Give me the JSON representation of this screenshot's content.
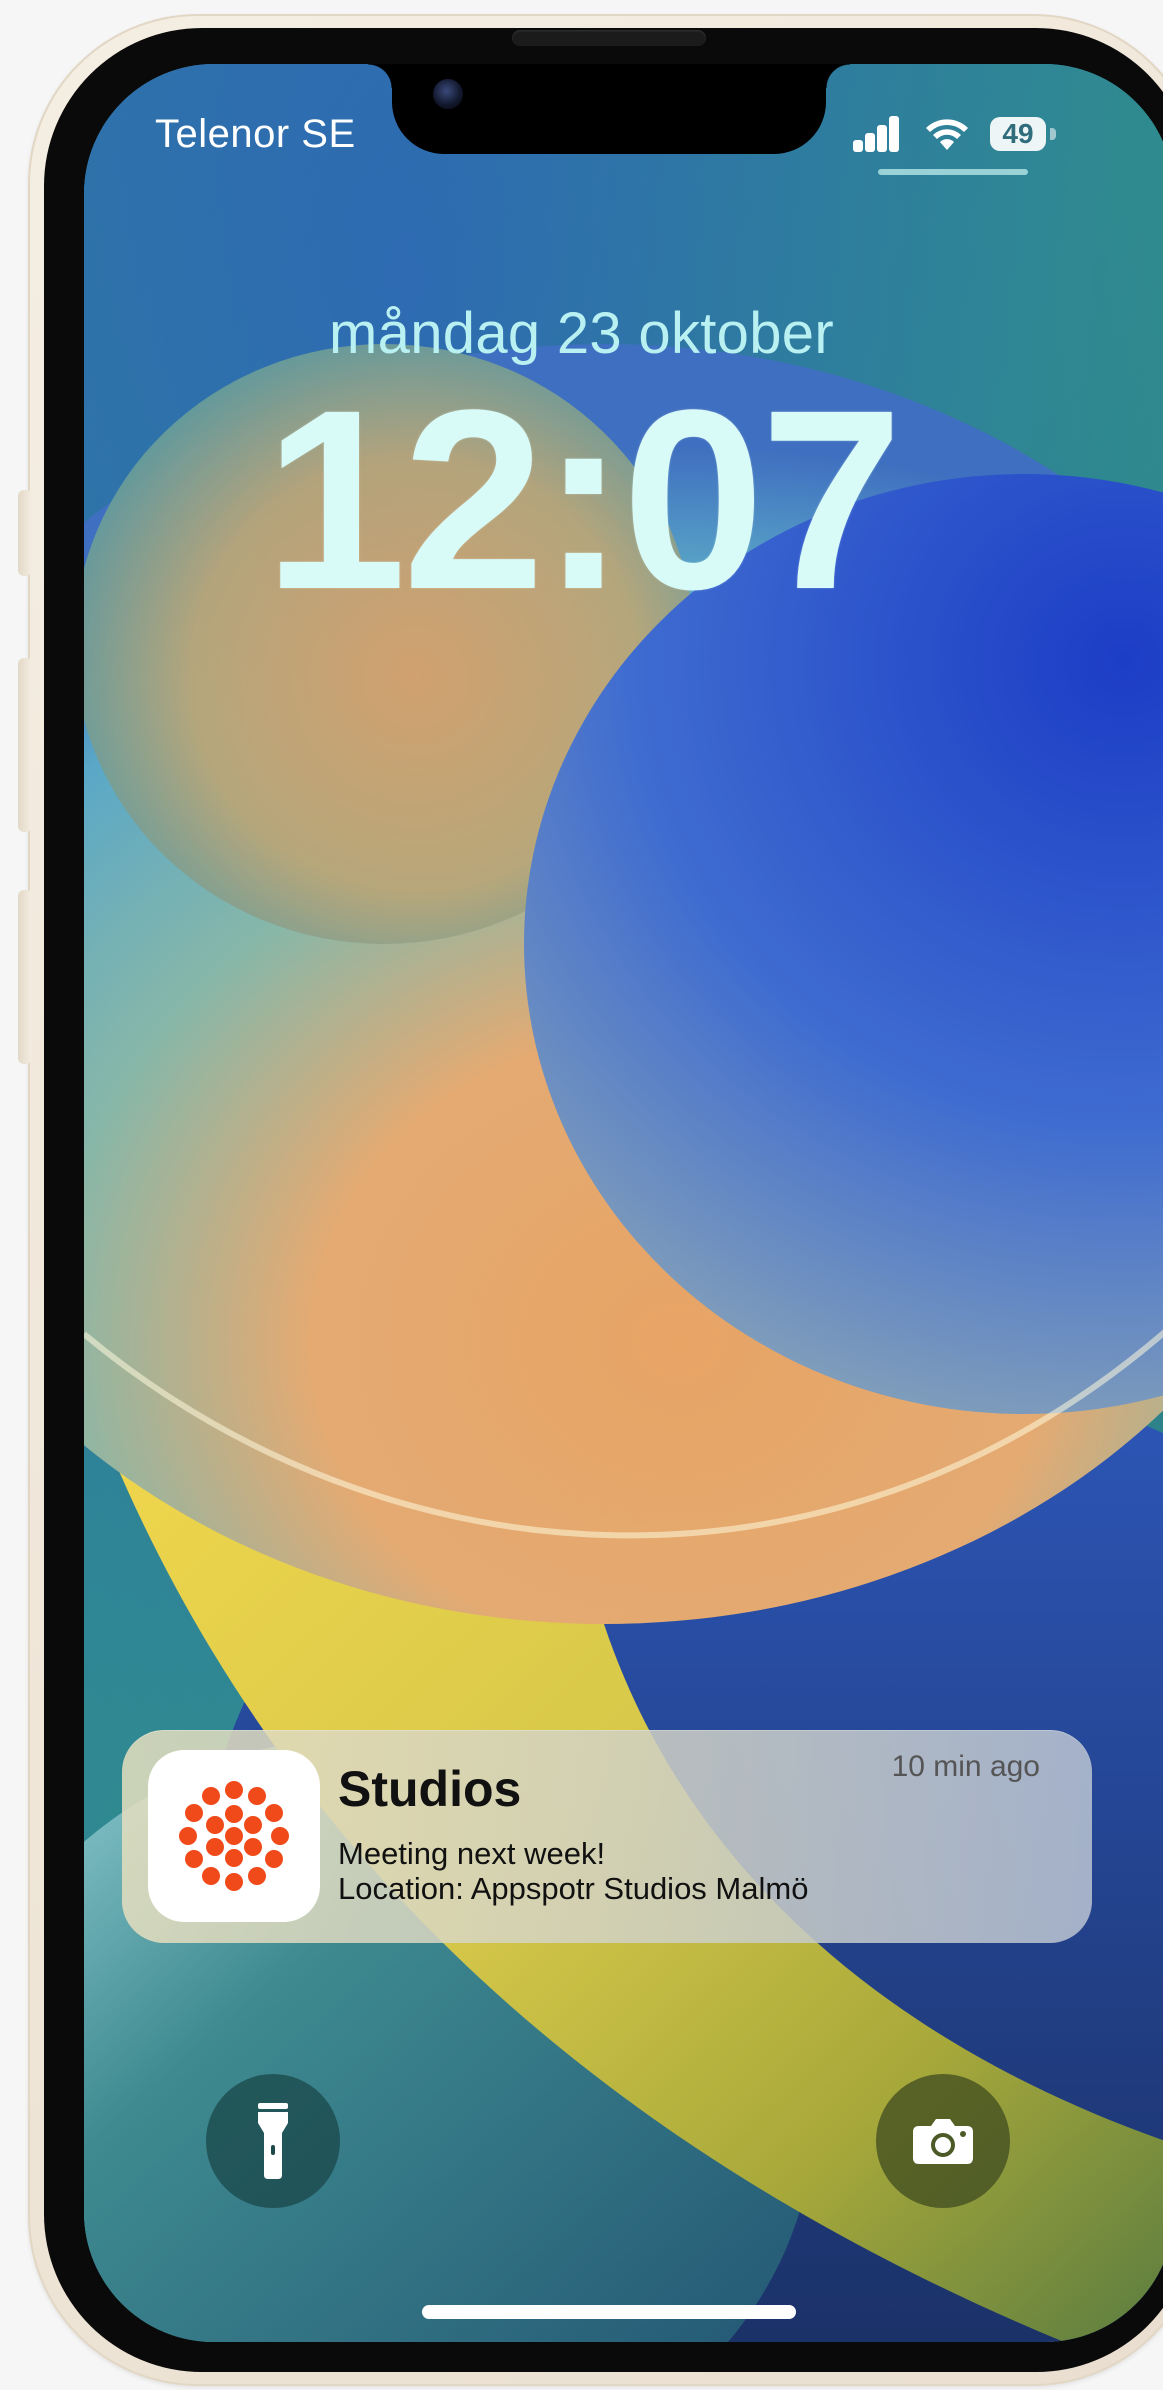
{
  "status_bar": {
    "carrier": "Telenor SE",
    "battery": "49",
    "signal_bars": 4,
    "wifi": "wifi-icon"
  },
  "lock_screen": {
    "date": "måndag 23 oktober",
    "time": "12:07"
  },
  "notification": {
    "app_name": "Studios",
    "time_ago": "10 min ago",
    "line1": "Meeting next week!",
    "line2": "Location: Appspotr Studios Malmö",
    "icon": "studios-app-icon",
    "icon_color": "#f04a1a"
  },
  "quick_actions": {
    "left": "flashlight-icon",
    "right": "camera-icon"
  },
  "colors": {
    "bezel": "#0a0a0a",
    "frame": "#f3ebdf",
    "wallpaper_blue": "#1d44c4",
    "wallpaper_peach": "#e9a36a",
    "wallpaper_yellow": "#ecd24c"
  }
}
